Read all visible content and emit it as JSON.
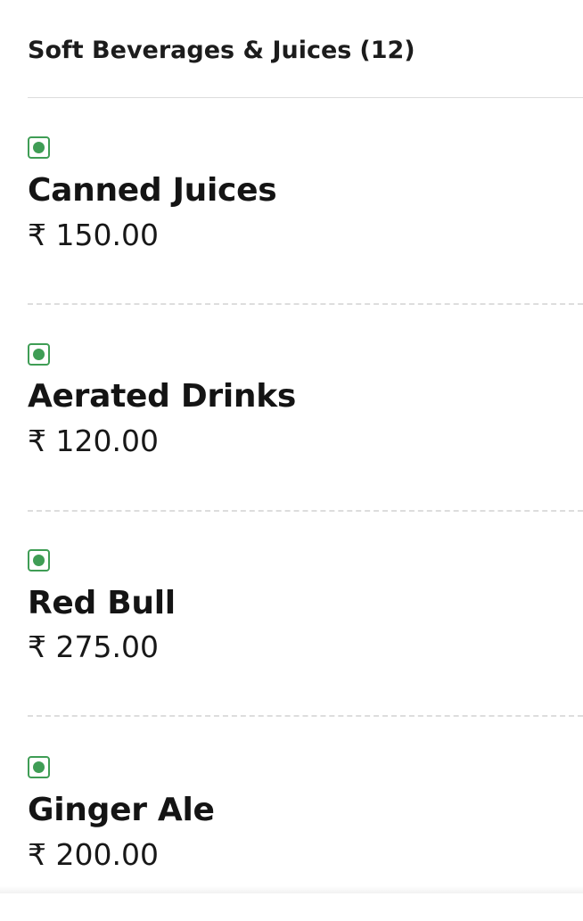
{
  "section": {
    "title": "Soft Beverages & Juices",
    "count": "(12)"
  },
  "items": [
    {
      "name": "Canned Juices",
      "price": "₹ 150.00",
      "veg_indicator": "veg-icon"
    },
    {
      "name": "Aerated Drinks",
      "price": "₹ 120.00",
      "veg_indicator": "veg-icon"
    },
    {
      "name": "Red Bull",
      "price": "₹ 275.00",
      "veg_indicator": "veg-icon"
    },
    {
      "name": "Ginger Ale",
      "price": "₹ 200.00",
      "veg_indicator": "veg-icon"
    }
  ],
  "colors": {
    "veg_green": "#3f9d55",
    "divider": "#dddddd",
    "text": "#141414"
  }
}
